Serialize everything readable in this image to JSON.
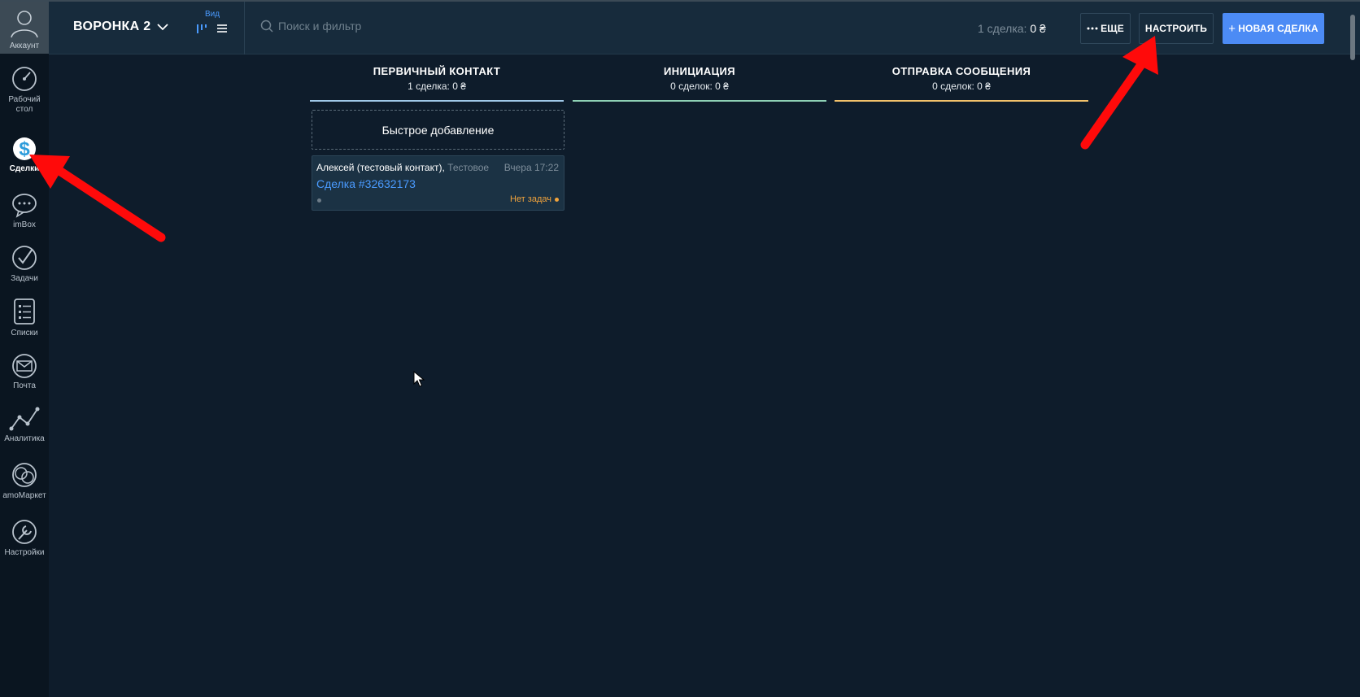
{
  "sidebar": {
    "account_label": "Аккаунт",
    "items": [
      {
        "label": "Рабочий стол",
        "icon": "dashboard-icon"
      },
      {
        "label": "Сделки",
        "icon": "deals-icon",
        "active": true
      },
      {
        "label": "imBox",
        "icon": "chat-icon"
      },
      {
        "label": "Задачи",
        "icon": "tasks-icon"
      },
      {
        "label": "Списки",
        "icon": "lists-icon"
      },
      {
        "label": "Почта",
        "icon": "mail-icon"
      },
      {
        "label": "Аналитика",
        "icon": "analytics-icon"
      },
      {
        "label": "amoМаркет",
        "icon": "market-icon"
      },
      {
        "label": "Настройки",
        "icon": "settings-icon"
      }
    ]
  },
  "header": {
    "pipeline_name": "ВОРОНКА 2",
    "view_label": "Вид",
    "search_placeholder": "Поиск и фильтр",
    "deal_summary_label": "1 сделка:",
    "deal_summary_value": "0 ₴",
    "more_label": "ЕЩЕ",
    "setup_label": "НАСТРОИТЬ",
    "new_deal_label": "НОВАЯ СДЕЛКА"
  },
  "columns": [
    {
      "title": "ПЕРВИЧНЫЙ КОНТАКТ",
      "summary": "1 сделка: 0 ₴",
      "color": "#9fc8e8"
    },
    {
      "title": "ИНИЦИАЦИЯ",
      "summary": "0 сделок: 0 ₴",
      "color": "#8ed1b5"
    },
    {
      "title": "ОТПРАВКА СООБЩЕНИЯ",
      "summary": "0 сделок: 0 ₴",
      "color": "#f2c26b"
    }
  ],
  "quick_add_label": "Быстрое добавление",
  "card": {
    "contact": "Алексей (тестовый контакт),",
    "company": "Тестовое",
    "date": "Вчера 17:22",
    "title": "Сделка #32632173",
    "tasks": "Нет задач"
  },
  "colors": {
    "accent": "#4c8bf5",
    "link": "#4a9bff",
    "warning": "#f2a43c",
    "annotation_arrow": "#ff0a0a"
  }
}
